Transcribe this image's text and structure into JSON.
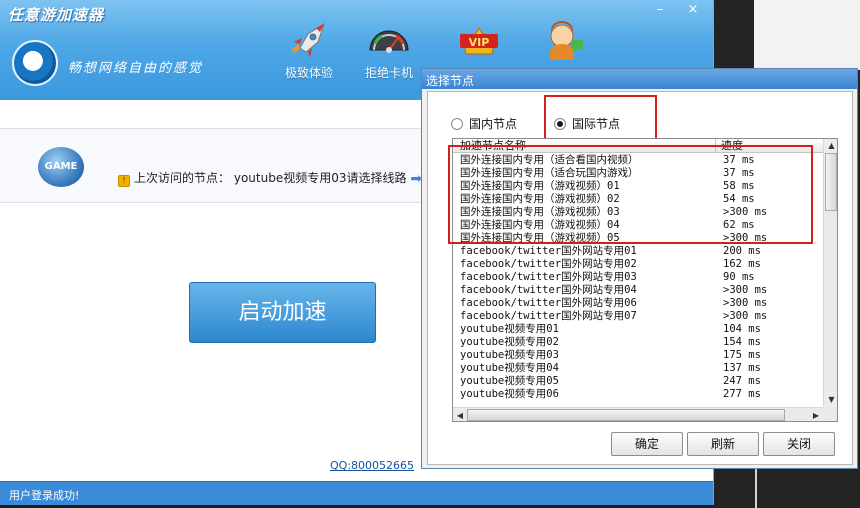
{
  "main": {
    "title": "任意游加速器",
    "window_buttons": {
      "minimize": "–",
      "close": "×"
    },
    "slogan": "畅想网络自由的感觉",
    "toolbar": [
      {
        "label": "极致体验",
        "icon": "rocket-icon"
      },
      {
        "label": "拒绝卡机",
        "icon": "speedometer-icon"
      },
      {
        "label": "",
        "icon": "vip-icon"
      },
      {
        "label": "",
        "icon": "support-agent-icon"
      }
    ],
    "game_icon_text": "GAME",
    "last_node_label": "上次访问的节点：",
    "last_node_value": "youtube视频专用03请选择线路",
    "start_button": "启动加速",
    "qq": "QQ:800052665",
    "status": "用户登录成功!"
  },
  "dialog": {
    "title": "选择节点",
    "radio_domestic": "国内节点",
    "radio_international": "国际节点",
    "selected_radio": "international",
    "columns": {
      "name": "加速节点名称",
      "speed": "速度"
    },
    "rows": [
      {
        "name": "国外连接国内专用（适合看国内视频）",
        "speed": " 37 ms"
      },
      {
        "name": "国外连接国内专用（适合玩国内游戏）",
        "speed": " 37 ms"
      },
      {
        "name": "国外连接国内专用（游戏视频）01",
        "speed": " 58 ms"
      },
      {
        "name": "国外连接国内专用（游戏视频）02",
        "speed": " 54 ms"
      },
      {
        "name": "国外连接国内专用（游戏视频）03",
        "speed": ">300 ms"
      },
      {
        "name": "国外连接国内专用（游戏视频）04",
        "speed": " 62 ms"
      },
      {
        "name": "国外连接国内专用（游戏视频）05",
        "speed": ">300 ms"
      },
      {
        "name": "facebook/twitter国外网站专用01",
        "speed": "200 ms"
      },
      {
        "name": "facebook/twitter国外网站专用02",
        "speed": "162 ms"
      },
      {
        "name": "facebook/twitter国外网站专用03",
        "speed": " 90 ms"
      },
      {
        "name": "facebook/twitter国外网站专用04",
        "speed": ">300 ms"
      },
      {
        "name": "facebook/twitter国外网站专用06",
        "speed": ">300 ms"
      },
      {
        "name": "facebook/twitter国外网站专用07",
        "speed": ">300 ms"
      },
      {
        "name": "youtube视频专用01",
        "speed": "104 ms"
      },
      {
        "name": "youtube视频专用02",
        "speed": "154 ms"
      },
      {
        "name": "youtube视频专用03",
        "speed": "175 ms"
      },
      {
        "name": "youtube视频专用04",
        "speed": "137 ms"
      },
      {
        "name": "youtube视频专用05",
        "speed": "247 ms"
      },
      {
        "name": "youtube视频专用06",
        "speed": "277 ms"
      }
    ],
    "buttons": {
      "ok": "确定",
      "refresh": "刷新",
      "close": "关闭"
    }
  },
  "colors": {
    "header_blue": "#3b98de",
    "highlight_red": "#d41f1f",
    "status_blue": "#3b8ad7"
  }
}
